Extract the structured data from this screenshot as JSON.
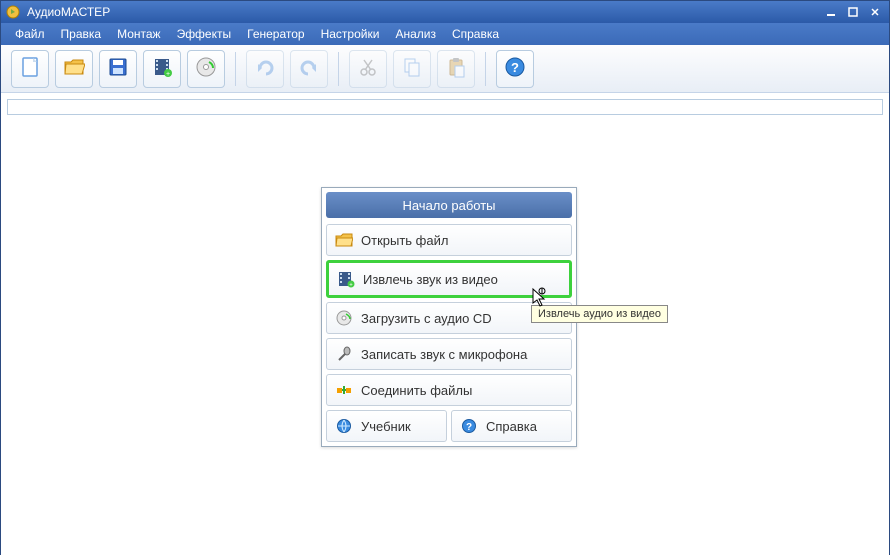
{
  "titlebar": {
    "title": "АудиоМАСТЕР"
  },
  "menu": {
    "items": [
      "Файл",
      "Правка",
      "Монтаж",
      "Эффекты",
      "Генератор",
      "Настройки",
      "Анализ",
      "Справка"
    ]
  },
  "toolbar": {
    "buttons": [
      {
        "name": "new-file",
        "disabled": false
      },
      {
        "name": "open-file",
        "disabled": false
      },
      {
        "name": "save-file",
        "disabled": false
      },
      {
        "name": "import-video",
        "disabled": false
      },
      {
        "name": "import-cd",
        "disabled": false
      },
      {
        "sep": true
      },
      {
        "name": "redo",
        "disabled": true
      },
      {
        "name": "undo",
        "disabled": true
      },
      {
        "sep": true
      },
      {
        "name": "cut",
        "disabled": true
      },
      {
        "name": "copy",
        "disabled": true
      },
      {
        "name": "paste",
        "disabled": true
      },
      {
        "sep": true
      },
      {
        "name": "help",
        "disabled": false
      }
    ]
  },
  "start": {
    "header": "Начало работы",
    "open": "Открыть файл",
    "extract": "Извлечь звук из видео",
    "cd": "Загрузить с аудио CD",
    "mic": "Записать звук с микрофона",
    "merge": "Соединить файлы",
    "tutorial": "Учебник",
    "help": "Справка"
  },
  "tooltip": "Извлечь аудио из видео"
}
